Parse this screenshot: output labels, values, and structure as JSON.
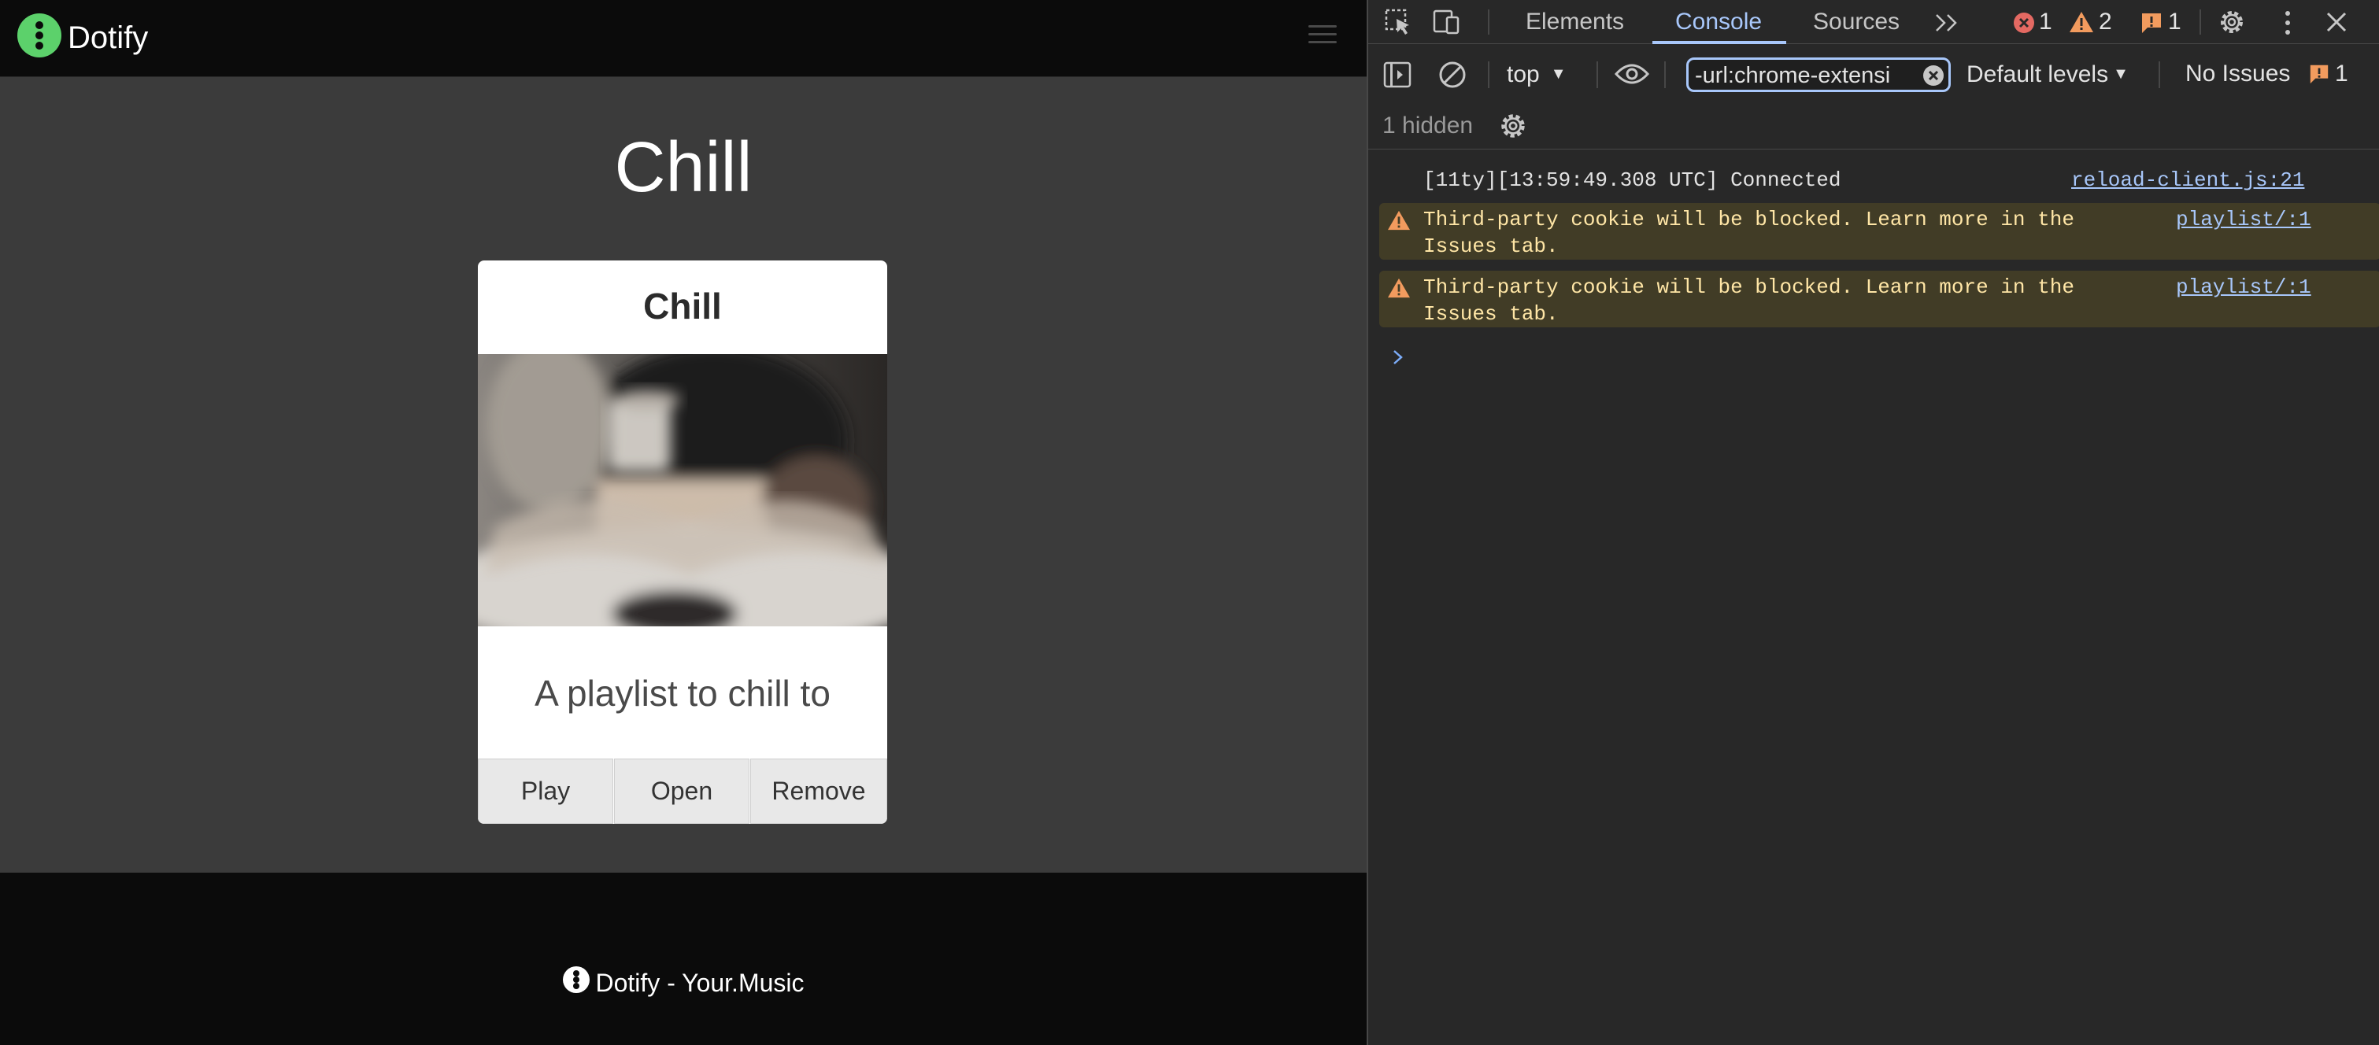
{
  "site": {
    "brand": "Dotify",
    "page_title": "Chill",
    "footer_text": "Dotify - Your.Music"
  },
  "card": {
    "title": "Chill",
    "image_alt": "Person holding a mug reading a book under a blanket",
    "description": "A playlist to chill to",
    "buttons": {
      "play": "Play",
      "open": "Open",
      "remove": "Remove"
    }
  },
  "devtools": {
    "tabs": {
      "elements": "Elements",
      "console": "Console",
      "sources": "Sources"
    },
    "counts": {
      "errors": "1",
      "warnings": "2",
      "info": "1"
    },
    "toolbar": {
      "context": "top",
      "filter_value": "-url:chrome-extensi",
      "levels": "Default levels",
      "issues_label": "No Issues",
      "issues_count": "1"
    },
    "hidden": "1 hidden",
    "console": {
      "lines": [
        {
          "text": "[11ty][13:59:49.308 UTC] Connected",
          "source": "reload-client.js:21"
        },
        {
          "text1": "Third-party cookie will be blocked. Learn more in the",
          "text2": "Issues tab.",
          "source": "playlist/:1"
        },
        {
          "text1": "Third-party cookie will be blocked. Learn more in the",
          "text2": "Issues tab.",
          "source": "playlist/:1"
        }
      ],
      "prompt": ">"
    }
  },
  "colors": {
    "brand_green": "#5cd16b",
    "console_accent": "#a8c7fa",
    "warning_bg": "#413c26",
    "warning_text": "#ffe6a6"
  }
}
